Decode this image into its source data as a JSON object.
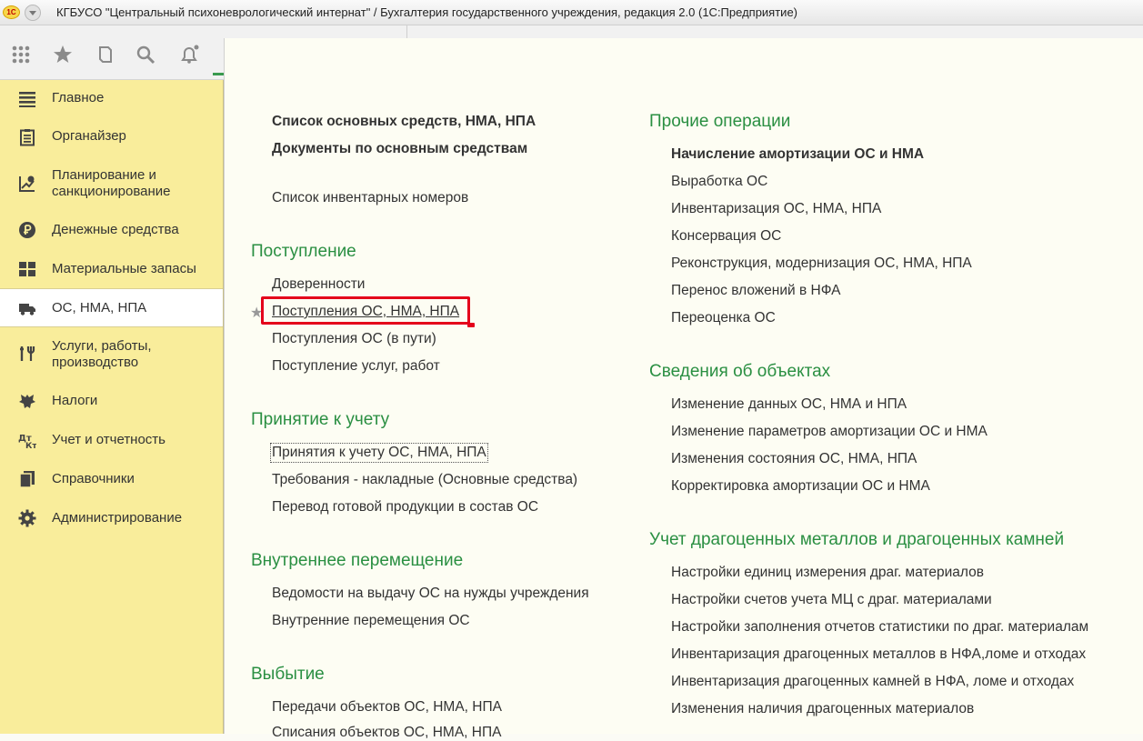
{
  "window": {
    "title": "КГБУСО \"Центральный психоневрологический интернат\" / Бухгалтерия государственного учреждения, редакция 2.0  (1С:Предприятие)",
    "logo_text": "1С"
  },
  "toolbar": {
    "icons": [
      "apps-grid-icon",
      "star-icon",
      "history-icon",
      "search-icon",
      "bell-icon"
    ]
  },
  "sidebar": {
    "items": [
      {
        "label": "Главное",
        "icon": "menu-lines-icon"
      },
      {
        "label": "Органайзер",
        "icon": "clipboard-icon"
      },
      {
        "label": "Планирование и санкционирование",
        "icon": "planning-chart-icon"
      },
      {
        "label": "Денежные средства",
        "icon": "ruble-coin-icon"
      },
      {
        "label": "Материальные запасы",
        "icon": "grid-blocks-icon"
      },
      {
        "label": "ОС, НМА, НПА",
        "icon": "truck-icon"
      },
      {
        "label": "Услуги, работы, производство",
        "icon": "tools-icon"
      },
      {
        "label": "Налоги",
        "icon": "eagle-emblem-icon"
      },
      {
        "label": "Учет и отчетность",
        "icon": "accounting-ledger-icon"
      },
      {
        "label": "Справочники",
        "icon": "books-icon"
      },
      {
        "label": "Администрирование",
        "icon": "gear-icon"
      }
    ],
    "active_index": 5
  },
  "content": {
    "left": {
      "top_links": [
        {
          "label": "Список основных средств, НМА, НПА",
          "bold": true
        },
        {
          "label": "Документы по основным средствам",
          "bold": true
        },
        {
          "label": "Список инвентарных номеров",
          "bold": false
        }
      ],
      "sections": [
        {
          "title": "Поступление",
          "items": [
            "Доверенности",
            "Поступления ОС, НМА, НПА",
            "Поступления ОС (в пути)",
            "Поступление услуг, работ"
          ]
        },
        {
          "title": "Принятие к учету",
          "items": [
            "Принятия к учету ОС, НМА, НПА",
            "Требования - накладные (Основные средства)",
            "Перевод готовой продукции в состав ОС"
          ]
        },
        {
          "title": "Внутреннее перемещение",
          "items": [
            "Ведомости на выдачу ОС на нужды учреждения",
            "Внутренние перемещения ОС"
          ]
        },
        {
          "title": "Выбытие",
          "items": [
            "Передачи объектов ОС, НМА, НПА",
            "Списания объектов ОС, НМА, НПА"
          ]
        }
      ]
    },
    "right": {
      "sections": [
        {
          "title": "Прочие операции",
          "items": [
            "Начисление амортизации ОС и НМА",
            "Выработка ОС",
            "Инвентаризация ОС, НМА, НПА",
            "Консервация ОС",
            "Реконструкция, модернизация ОС, НМА, НПА",
            "Перенос вложений в НФА",
            "Переоценка ОС"
          ]
        },
        {
          "title": "Сведения об объектах",
          "items": [
            "Изменение данных ОС, НМА и НПА",
            "Изменение параметров амортизации ОС и НМА",
            "Изменения состояния ОС, НМА, НПА",
            "Корректировка амортизации ОС и НМА"
          ]
        },
        {
          "title": "Учет драгоценных металлов и драгоценных камней",
          "items": [
            "Настройки единиц измерения драг. материалов",
            "Настройки счетов учета МЦ с драг. материалами",
            "Настройки заполнения отчетов статистики по драг. материалам",
            "Инвентаризация драгоценных металлов в НФА,ломе и отходах",
            "Инвентаризация драгоценных камней в НФА, ломе и отходах",
            "Изменения наличия драгоценных материалов"
          ]
        }
      ]
    },
    "star_glyph": "★"
  },
  "colors": {
    "sidebar_bg": "#f9ed9b",
    "section_title": "#2a8f42",
    "highlight": "#e4001b"
  }
}
